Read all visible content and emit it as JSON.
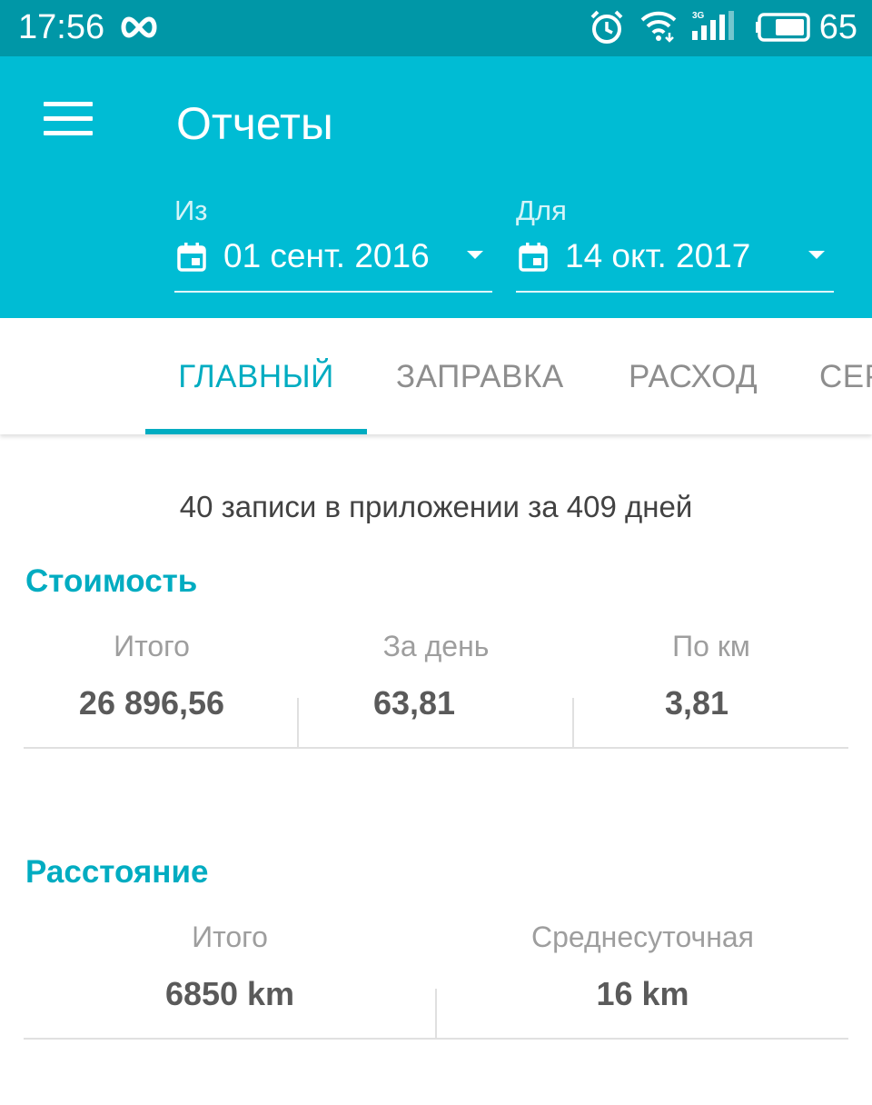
{
  "status_bar": {
    "time": "17:56",
    "battery_level": "65",
    "background_color": "#0097a7"
  },
  "app_bar": {
    "title": "Отчеты",
    "background_color": "#00bcd4",
    "from": {
      "label": "Из",
      "value": "01 сент. 2016"
    },
    "to": {
      "label": "Для",
      "value": "14 окт. 2017"
    }
  },
  "tabs": [
    {
      "label": "ГЛАВНЫЙ",
      "active": true
    },
    {
      "label": "ЗАПРАВКА",
      "active": false
    },
    {
      "label": "РАСХОД",
      "active": false
    },
    {
      "label": "СЕР",
      "active": false
    }
  ],
  "accent_color": "#00acc1",
  "summary": "40 записи в приложении за 409 дней",
  "cost": {
    "title": "Стоимость",
    "stats": [
      {
        "label": "Итого",
        "value": "26 896,56"
      },
      {
        "label": "За день",
        "value": "63,81"
      },
      {
        "label": "По км",
        "value": "3,81"
      }
    ]
  },
  "distance": {
    "title": "Расстояние",
    "stats": [
      {
        "label": "Итого",
        "value": "6850 km"
      },
      {
        "label": "Среднесуточная",
        "value": "16 km"
      }
    ]
  }
}
